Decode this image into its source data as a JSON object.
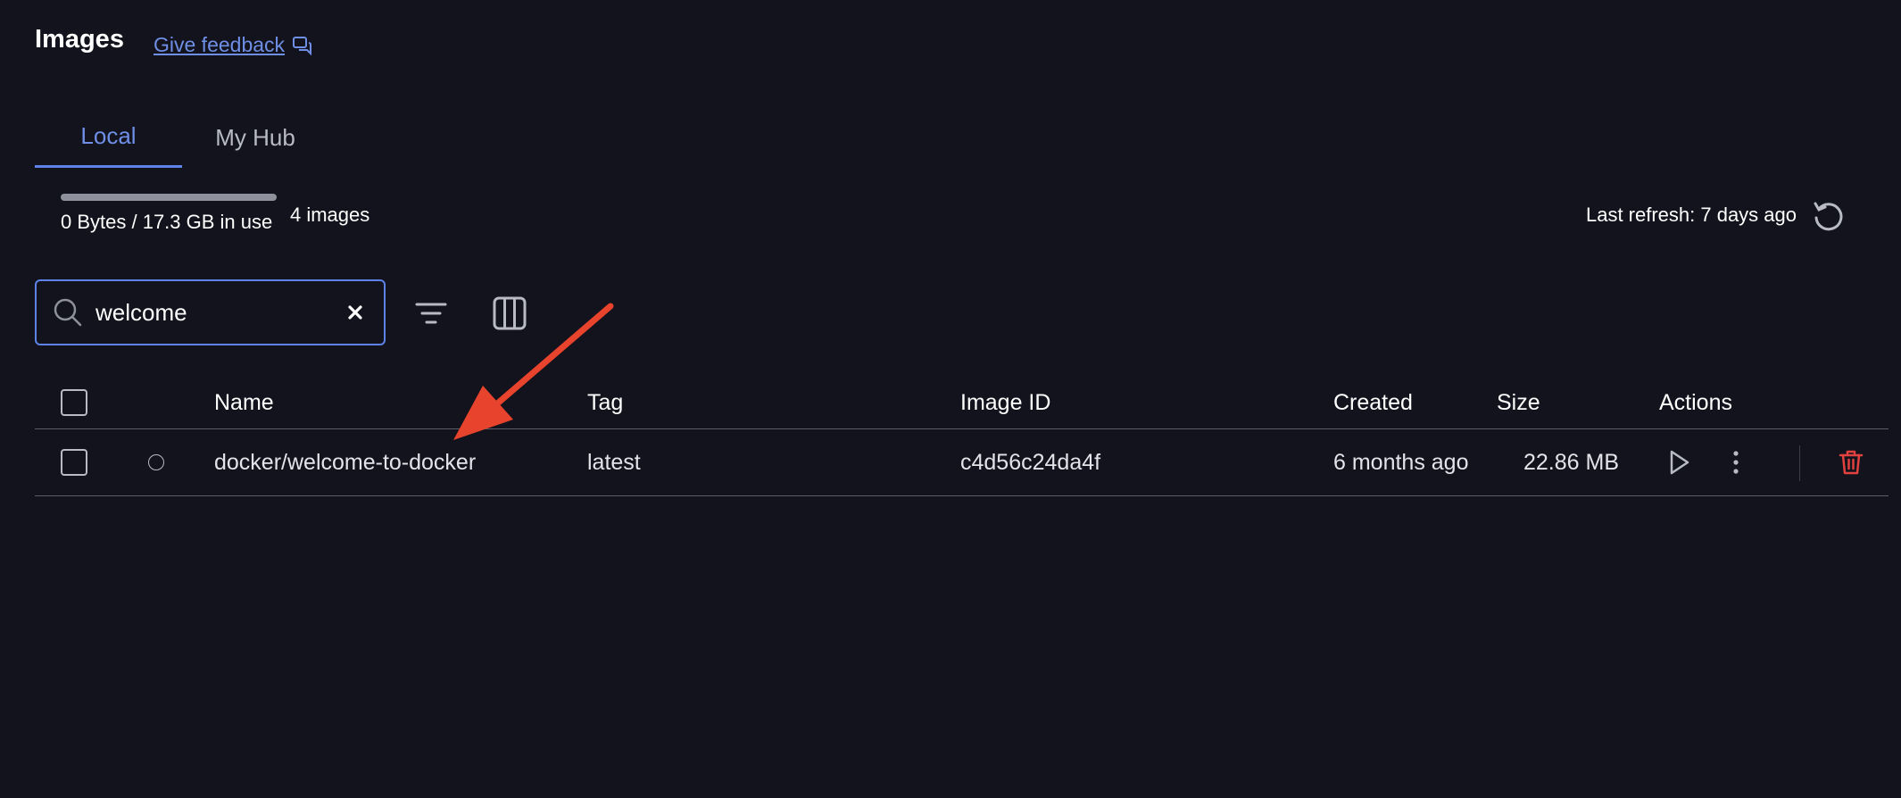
{
  "header": {
    "title": "Images",
    "feedback_label": "Give feedback"
  },
  "tabs": [
    {
      "label": "Local",
      "active": true
    },
    {
      "label": "My Hub",
      "active": false
    }
  ],
  "usage": {
    "text": "0 Bytes / 17.3 GB in use",
    "fraction": 0,
    "images_count": "4 images"
  },
  "refresh": {
    "text": "Last refresh: 7 days ago",
    "icon": "refresh-icon"
  },
  "search": {
    "value": "welcome",
    "placeholder": "Search",
    "icon": "search-icon"
  },
  "toolbar": {
    "filter_icon": "filter-icon",
    "columns_icon": "columns-icon"
  },
  "table": {
    "headers": {
      "name": "Name",
      "tag": "Tag",
      "image_id": "Image ID",
      "created": "Created",
      "size": "Size",
      "actions": "Actions"
    },
    "rows": [
      {
        "name": "docker/welcome-to-docker",
        "tag": "latest",
        "image_id": "c4d56c24da4f",
        "created": "6 months ago",
        "size": "22.86 MB",
        "status": "unused"
      }
    ]
  },
  "colors": {
    "background": "#12131c",
    "accent": "#5d83e8",
    "link": "#6f8fe6",
    "danger": "#e0423f",
    "annotation_arrow": "#e8432d"
  }
}
